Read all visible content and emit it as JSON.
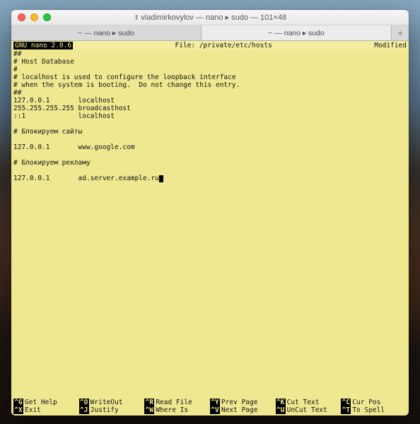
{
  "titlebar": {
    "prefix": "⬆",
    "title": "vladimirkovylov — nano ▸ sudo — 101×48"
  },
  "tabs": [
    {
      "label": "~ — nano ▸ sudo",
      "active": false
    },
    {
      "label": "~ — nano ▸ sudo",
      "active": true
    }
  ],
  "nano": {
    "header_left": "GNU nano 2.0.6",
    "header_center": "File: /private/etc/hosts",
    "header_right": "Modified"
  },
  "file_lines": [
    "##",
    "# Host Database",
    "#",
    "# localhost is used to configure the loopback interface",
    "# when the system is booting.  Do not change this entry.",
    "##",
    "127.0.0.1       localhost",
    "255.255.255.255 broadcasthost",
    "::1             localhost",
    "",
    "# Блокируем сайты",
    "",
    "127.0.0.1       www.google.com",
    "",
    "# Блокируем рекламу",
    "",
    "127.0.0.1       ad.server.example.ru"
  ],
  "shortcuts": {
    "row1": [
      {
        "k": "^G",
        "l": "Get Help"
      },
      {
        "k": "^O",
        "l": "WriteOut"
      },
      {
        "k": "^R",
        "l": "Read File"
      },
      {
        "k": "^Y",
        "l": "Prev Page"
      },
      {
        "k": "^K",
        "l": "Cut Text"
      },
      {
        "k": "^C",
        "l": "Cur Pos"
      }
    ],
    "row2": [
      {
        "k": "^X",
        "l": "Exit"
      },
      {
        "k": "^J",
        "l": "Justify"
      },
      {
        "k": "^W",
        "l": "Where Is"
      },
      {
        "k": "^V",
        "l": "Next Page"
      },
      {
        "k": "^U",
        "l": "UnCut Text"
      },
      {
        "k": "^T",
        "l": "To Spell"
      }
    ]
  }
}
